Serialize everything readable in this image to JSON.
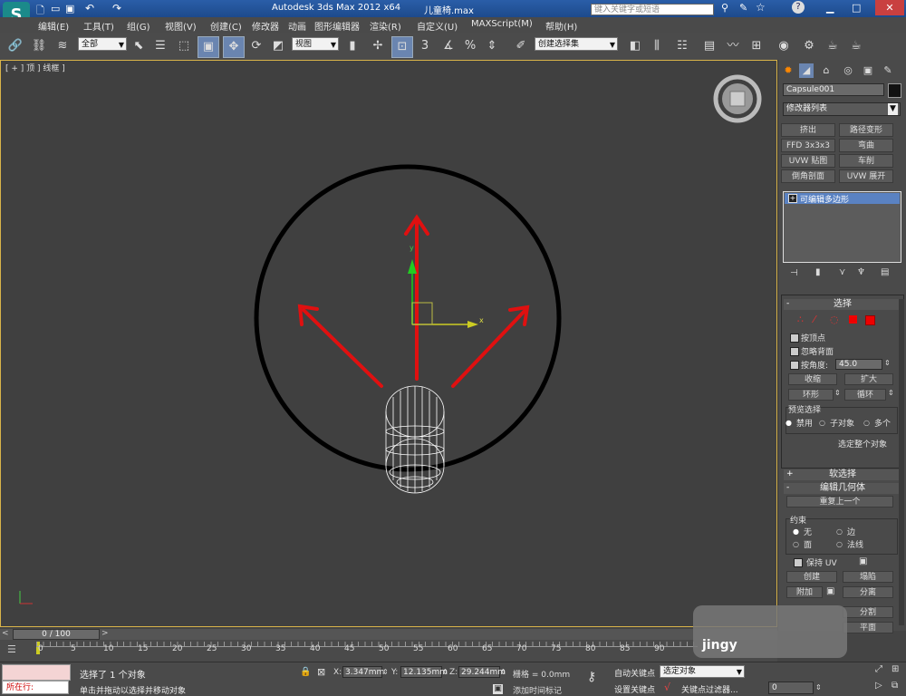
{
  "title": {
    "app": "Autodesk 3ds Max  2012 x64",
    "file": "儿童椅.max"
  },
  "search": {
    "placeholder": "键入关键字或短语"
  },
  "menu": [
    "编辑(E)",
    "工具(T)",
    "组(G)",
    "视图(V)",
    "创建(C)",
    "修改器",
    "动画",
    "图形编辑器",
    "渲染(R)",
    "自定义(U)",
    "MAXScript(M)",
    "帮助(H)"
  ],
  "toolbar": {
    "selection_filter": "全部",
    "ref_coord": "视图",
    "named_selection": "创建选择集",
    "snap_label": "3"
  },
  "viewport": {
    "label": "[ + ] 顶 ] 线框 ]"
  },
  "panel": {
    "object_name": "Capsule001",
    "modifier_list": "修改器列表",
    "mod_buttons": [
      "挤出",
      "路径变形",
      "FFD 3x3x3",
      "弯曲",
      "UVW 贴图",
      "车削",
      "倒角剖面",
      "UVW 展开"
    ],
    "stack_item": "可编辑多边形",
    "select_title": "选择",
    "by_vertex": "按顶点",
    "ignore_backface": "忽略背面",
    "by_angle": "按角度:",
    "angle_value": "45.0",
    "shrink": "收缩",
    "grow": "扩大",
    "ring": "环形",
    "loop": "循环",
    "preview_title": "预览选择",
    "preview_opts": [
      "禁用",
      "子对象",
      "多个"
    ],
    "select_whole": "选定整个对象",
    "soft_select": "软选择",
    "edit_geometry": "编辑几何体",
    "repeat_last": "重复上一个",
    "constraints_title": "约束",
    "constraints": [
      "无",
      "边",
      "面",
      "法线"
    ],
    "preserve_uv": "保持 UV",
    "create": "创建",
    "collapse": "塌陷",
    "attach": "附加",
    "detach": "分离",
    "slice": "分割",
    "plane": "平面"
  },
  "timeline": {
    "frame": "0 / 100",
    "ticks": [
      "0",
      "5",
      "10",
      "15",
      "20",
      "25",
      "30",
      "35",
      "40",
      "45",
      "50",
      "55",
      "60",
      "65",
      "70",
      "75",
      "80",
      "85",
      "90"
    ]
  },
  "status": {
    "in_use": "所在行:",
    "selected": "选择了 1 个对象",
    "prompt": "单击并拖动以选择并移动对象",
    "x": "3.347mm",
    "y": "12.135mm",
    "z": "29.244mm",
    "grid": "栅格 = 0.0mm",
    "add_time_tag": "添加时间标记",
    "auto_key": "自动关键点",
    "set_key": "设置关键点",
    "key_mode": "选定对象",
    "key_filters": "关键点过滤器...",
    "frame_field": "0"
  },
  "watermark": "jingy"
}
